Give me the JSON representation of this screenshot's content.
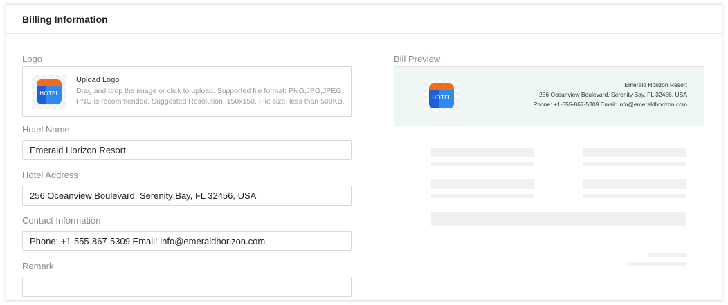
{
  "panel": {
    "title": "Billing Information"
  },
  "logo": {
    "label": "Logo",
    "upload_title": "Upload Logo",
    "hint_line1": "Drag and drop the image or click to upload. Supported file format: PNG,JPG,JPEG.",
    "hint_line2": "PNG is recommended. Suggested Resolution: 150x150. File size: less than 500KB.",
    "logo_text": "HOTEL",
    "colors": {
      "orange": "#ef6c1a",
      "blue_dark": "#1e5fd6",
      "blue_light": "#2f88f3"
    }
  },
  "hotel_name": {
    "label": "Hotel Name",
    "value": "Emerald Horizon Resort"
  },
  "hotel_address": {
    "label": "Hotel Address",
    "value": "256 Oceanview Boulevard, Serenity Bay, FL 32456, USA"
  },
  "contact": {
    "label": "Contact Information",
    "value": "Phone: +1-555-867-5309 Email: info@emeraldhorizon.com"
  },
  "remark": {
    "label": "Remark",
    "value": ""
  },
  "preview": {
    "label": "Bill Preview",
    "hotel_name": "Emerald Horizon Resort",
    "hotel_address": "256 Oceanview Boulevard, Serenity Bay, FL 32456, USA",
    "contact": "Phone: +1-555-867-5309 Email: info@emeraldhorizon.com",
    "header_bg": "#eef6f6",
    "placeholder_color": "#f0f0f0"
  }
}
